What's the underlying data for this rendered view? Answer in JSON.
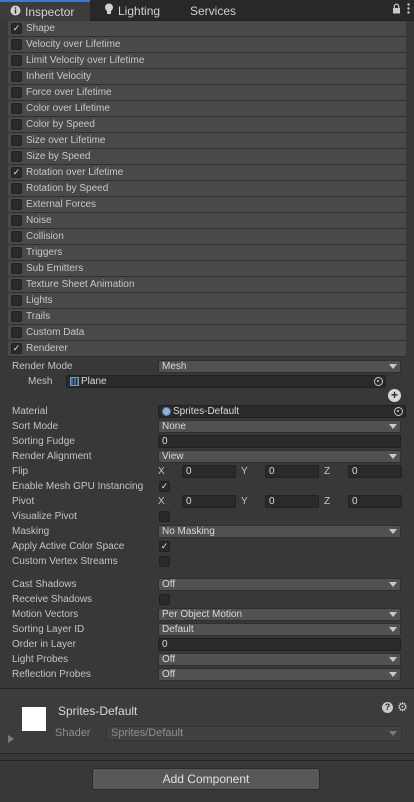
{
  "tabs": [
    {
      "label": "Inspector",
      "icon": "info-icon",
      "active": true
    },
    {
      "label": "Lighting",
      "icon": "bulb-icon",
      "active": false
    },
    {
      "label": "Services",
      "icon": "",
      "active": false
    }
  ],
  "modules": [
    {
      "label": "Shape",
      "checked": true
    },
    {
      "label": "Velocity over Lifetime",
      "checked": false
    },
    {
      "label": "Limit Velocity over Lifetime",
      "checked": false
    },
    {
      "label": "Inherit Velocity",
      "checked": false
    },
    {
      "label": "Force over Lifetime",
      "checked": false
    },
    {
      "label": "Color over Lifetime",
      "checked": false
    },
    {
      "label": "Color by Speed",
      "checked": false
    },
    {
      "label": "Size over Lifetime",
      "checked": false
    },
    {
      "label": "Size by Speed",
      "checked": false
    },
    {
      "label": "Rotation over Lifetime",
      "checked": true
    },
    {
      "label": "Rotation by Speed",
      "checked": false
    },
    {
      "label": "External Forces",
      "checked": false
    },
    {
      "label": "Noise",
      "checked": false
    },
    {
      "label": "Collision",
      "checked": false
    },
    {
      "label": "Triggers",
      "checked": false
    },
    {
      "label": "Sub Emitters",
      "checked": false
    },
    {
      "label": "Texture Sheet Animation",
      "checked": false
    },
    {
      "label": "Lights",
      "checked": false
    },
    {
      "label": "Trails",
      "checked": false
    },
    {
      "label": "Custom Data",
      "checked": false
    },
    {
      "label": "Renderer",
      "checked": true
    }
  ],
  "renderer": {
    "render_mode": {
      "label": "Render Mode",
      "value": "Mesh"
    },
    "mesh": {
      "label": "Mesh",
      "value": "Plane"
    },
    "material": {
      "label": "Material",
      "value": "Sprites-Default"
    },
    "sort_mode": {
      "label": "Sort Mode",
      "value": "None"
    },
    "sorting_fudge": {
      "label": "Sorting Fudge",
      "value": "0"
    },
    "render_alignment": {
      "label": "Render Alignment",
      "value": "View"
    },
    "flip": {
      "label": "Flip",
      "x_label": "X",
      "x": "0",
      "y_label": "Y",
      "y": "0",
      "z_label": "Z",
      "z": "0"
    },
    "gpu_instancing": {
      "label": "Enable Mesh GPU Instancing",
      "checked": true
    },
    "pivot": {
      "label": "Pivot",
      "x_label": "X",
      "x": "0",
      "y_label": "Y",
      "y": "0",
      "z_label": "Z",
      "z": "0"
    },
    "visualize_pivot": {
      "label": "Visualize Pivot",
      "checked": false
    },
    "masking": {
      "label": "Masking",
      "value": "No Masking"
    },
    "apply_active_color_space": {
      "label": "Apply Active Color Space",
      "checked": true
    },
    "custom_vertex_streams": {
      "label": "Custom Vertex Streams",
      "checked": false
    },
    "cast_shadows": {
      "label": "Cast Shadows",
      "value": "Off"
    },
    "receive_shadows": {
      "label": "Receive Shadows",
      "checked": false
    },
    "motion_vectors": {
      "label": "Motion Vectors",
      "value": "Per Object Motion"
    },
    "sorting_layer_id": {
      "label": "Sorting Layer ID",
      "value": "Default"
    },
    "order_in_layer": {
      "label": "Order in Layer",
      "value": "0"
    },
    "light_probes": {
      "label": "Light Probes",
      "value": "Off"
    },
    "reflection_probes": {
      "label": "Reflection Probes",
      "value": "Off"
    }
  },
  "material_panel": {
    "name": "Sprites-Default",
    "shader_label": "Shader",
    "shader_value": "Sprites/Default",
    "swatch_color": "#ffffff"
  },
  "add_component_label": "Add Component",
  "colors": {
    "accent": "#3a79d6",
    "background": "#383838",
    "module_header": "#494949"
  }
}
